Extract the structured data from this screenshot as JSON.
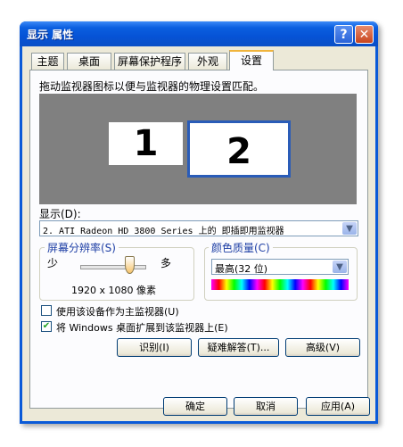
{
  "window": {
    "title": "显示 属性",
    "help_icon": "?",
    "close_icon": "✕"
  },
  "tabs": [
    {
      "label": "主题",
      "active": false
    },
    {
      "label": "桌面",
      "active": false
    },
    {
      "label": "屏幕保护程序",
      "active": false
    },
    {
      "label": "外观",
      "active": false
    },
    {
      "label": "设置",
      "active": true
    }
  ],
  "settings": {
    "instruction": "拖动监视器图标以便与监视器的物理设置匹配。",
    "monitors": [
      {
        "number": "1"
      },
      {
        "number": "2"
      }
    ],
    "display_label": "显示(D):",
    "display_value": "2. ATI Radeon HD 3800 Series  上的 即插即用监视器",
    "resolution": {
      "group_label": "屏幕分辨率(S)",
      "less": "少",
      "more": "多",
      "value": "1920 x 1080 像素"
    },
    "color_quality": {
      "group_label": "颜色质量(C)",
      "value": "最高(32 位)"
    },
    "primary_checkbox": {
      "label": "使用该设备作为主监视器(U)",
      "checked": false
    },
    "extend_checkbox": {
      "label": "将 Windows 桌面扩展到该监视器上(E)",
      "checked": true
    },
    "buttons": {
      "identify": "识别(I)",
      "troubleshoot": "疑难解答(T)...",
      "advanced": "高级(V)"
    }
  },
  "dialog_buttons": {
    "ok": "确定",
    "cancel": "取消",
    "apply": "应用(A)"
  },
  "colors": {
    "titlebar": "#0b5fe0",
    "face": "#ece9d8",
    "monitor_selected_border": "#2a5cb8"
  }
}
